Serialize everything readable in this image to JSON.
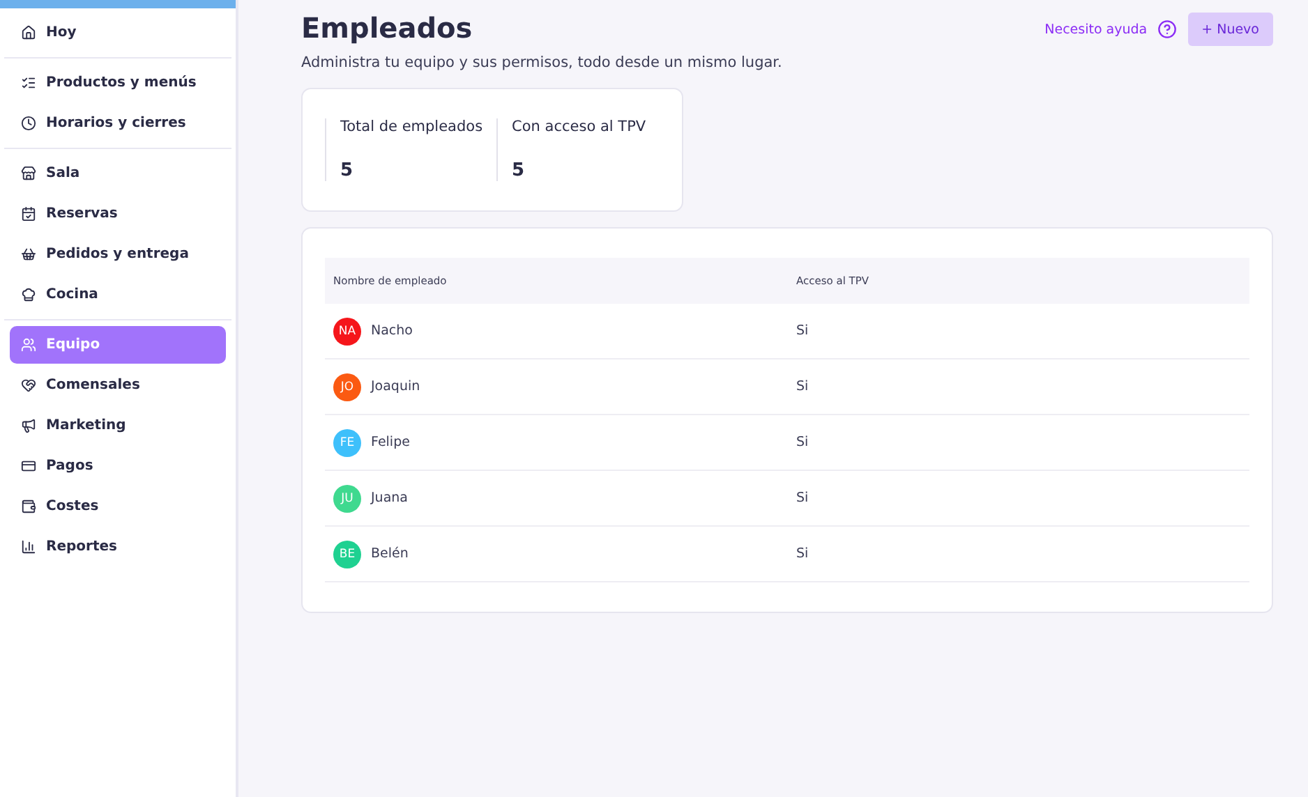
{
  "sidebar": {
    "groups": [
      {
        "items": [
          {
            "label": "Hoy",
            "selected": false
          }
        ]
      },
      {
        "items": [
          {
            "label": "Productos y menús",
            "selected": false
          },
          {
            "label": "Horarios y cierres",
            "selected": false
          }
        ]
      },
      {
        "items": [
          {
            "label": "Sala",
            "selected": false
          },
          {
            "label": "Reservas",
            "selected": false
          },
          {
            "label": "Pedidos y entrega",
            "selected": false
          },
          {
            "label": "Cocina",
            "selected": false
          }
        ]
      },
      {
        "items": [
          {
            "label": "Equipo",
            "selected": true
          },
          {
            "label": "Comensales",
            "selected": false
          },
          {
            "label": "Marketing",
            "selected": false
          },
          {
            "label": "Pagos",
            "selected": false
          },
          {
            "label": "Costes",
            "selected": false
          },
          {
            "label": "Reportes",
            "selected": false
          }
        ]
      }
    ]
  },
  "header": {
    "title": "Empleados",
    "subtitle": "Administra tu equipo y sus permisos, todo desde un mismo lugar.",
    "help_link": "Necesito ayuda",
    "new_button": "+ Nuevo"
  },
  "stats": [
    {
      "label": "Total de empleados",
      "value": "5"
    },
    {
      "label": "Con acceso al TPV",
      "value": "5"
    }
  ],
  "table": {
    "columns": [
      "Nombre de empleado",
      "Acceso al TPV"
    ],
    "rows": [
      {
        "initials": "NA",
        "color": "#f5161b",
        "name": "Nacho",
        "access": "Si"
      },
      {
        "initials": "JO",
        "color": "#fb5a12",
        "name": "Joaquin",
        "access": "Si"
      },
      {
        "initials": "FE",
        "color": "#3ec0fb",
        "name": "Felipe",
        "access": "Si"
      },
      {
        "initials": "JU",
        "color": "#3fd98f",
        "name": "Juana",
        "access": "Si"
      },
      {
        "initials": "BE",
        "color": "#1fd191",
        "name": "Belén",
        "access": "Si"
      }
    ]
  }
}
